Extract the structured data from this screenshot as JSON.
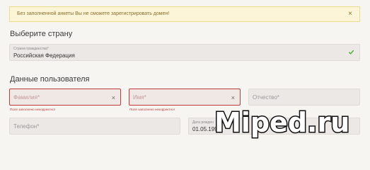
{
  "alert": {
    "text": "Без заполненной анкеты Вы не сможете зарегистрировать домен!",
    "close": "×"
  },
  "country": {
    "heading": "Выберите страну",
    "label": "Страна гражданства*",
    "value": "Российская Федерация"
  },
  "user": {
    "heading": "Данные пользователя",
    "surname": {
      "placeholder": "Фамилия*",
      "clear": "×",
      "error": "Поле заполнено некорректно!"
    },
    "name": {
      "placeholder": "Имя*",
      "clear": "×",
      "error": "Поле заполнено некорректно!"
    },
    "patronymic": {
      "placeholder": "Отчество*"
    },
    "phone": {
      "placeholder": "Телефон*"
    },
    "birthdate": {
      "label": "Дата рожден",
      "value": "01.05.1997"
    }
  },
  "watermark": {
    "text": "Miped.ru"
  },
  "colors": {
    "error": "#c0393b",
    "success": "#4fae3b",
    "alert_bg": "#fcf5d7"
  }
}
